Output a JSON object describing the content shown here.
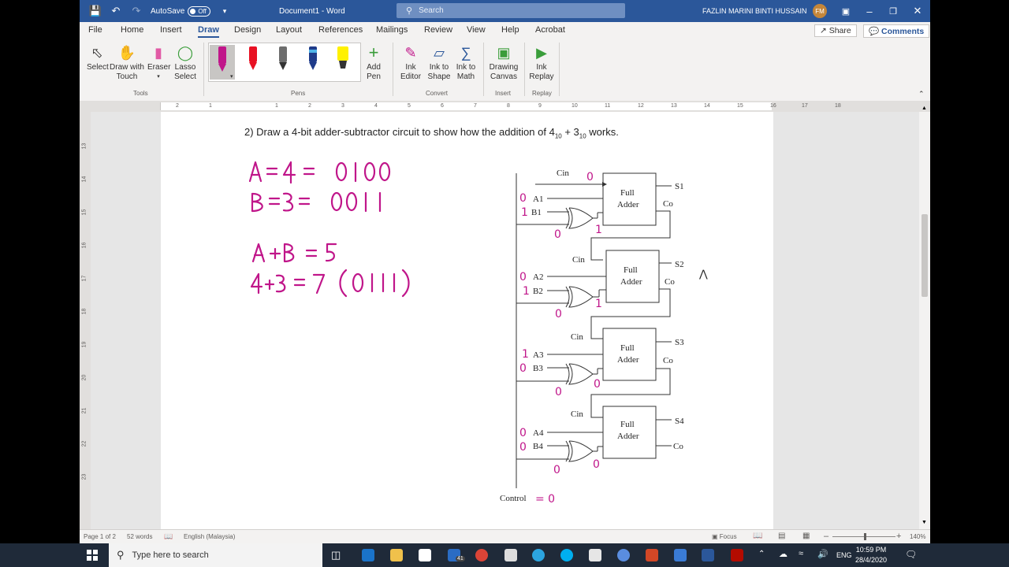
{
  "titlebar": {
    "autosave_label": "AutoSave",
    "autosave_state": "Off",
    "doc_title": "Document1  -  Word",
    "search_placeholder": "Search",
    "user_name": "FAZLIN MARINI BINTI HUSSAIN",
    "user_initials": "FM"
  },
  "tabs": [
    "File",
    "Home",
    "Insert",
    "Draw",
    "Design",
    "Layout",
    "References",
    "Mailings",
    "Review",
    "View",
    "Help",
    "Acrobat"
  ],
  "share_label": "Share",
  "comments_label": "Comments",
  "ribbon": {
    "select": "Select",
    "draw_touch_1": "Draw with",
    "draw_touch_2": "Touch",
    "eraser": "Eraser",
    "lasso_1": "Lasso",
    "lasso_2": "Select",
    "group_tools": "Tools",
    "group_pens": "Pens",
    "add_pen_1": "Add",
    "add_pen_2": "Pen",
    "ink_editor_1": "Ink",
    "ink_editor_2": "Editor",
    "ink_shape_1": "Ink to",
    "ink_shape_2": "Shape",
    "ink_math_1": "Ink to",
    "ink_math_2": "Math",
    "group_convert": "Convert",
    "drawing_canvas_1": "Drawing",
    "drawing_canvas_2": "Canvas",
    "group_insert": "Insert",
    "ink_replay_1": "Ink",
    "ink_replay_2": "Replay",
    "group_replay": "Replay"
  },
  "pens": [
    {
      "color": "#c0168a"
    },
    {
      "color": "#e81123"
    },
    {
      "color": "#7a7a7a"
    },
    {
      "color": "#1f3b8a"
    },
    {
      "color": "#fff100"
    }
  ],
  "ruler_numbers": [
    "2",
    "1",
    "1",
    "2",
    "3",
    "4",
    "5",
    "6",
    "7",
    "8",
    "9",
    "10",
    "11",
    "12",
    "13",
    "14",
    "15",
    "16",
    "17",
    "18"
  ],
  "vruler_numbers": [
    "13",
    "14",
    "15",
    "16",
    "17",
    "18",
    "19",
    "20",
    "21",
    "22",
    "23"
  ],
  "document": {
    "question_prefix": "2)  Draw a 4-bit adder-subtractor circuit to show how the addition of 4",
    "sub1": "10",
    "plus": " + 3",
    "sub2": "10",
    "suffix": " works.",
    "handwriting": {
      "line1": "A = 4 = 0100",
      "line2": "B = 3 = 0011",
      "line3": "A + B = 5",
      "line4": "4+3 = 7 (0111)"
    },
    "circuit": {
      "adder_label_1": "Full",
      "adder_label_2": "Adder",
      "cin": "Cin",
      "co": "Co",
      "control": "Control",
      "stages": [
        {
          "a": "A1",
          "b": "B1",
          "s": "S1",
          "a_val": "0",
          "b_val": "1",
          "xor_in": "0",
          "xor_out": "1"
        },
        {
          "a": "A2",
          "b": "B2",
          "s": "S2",
          "a_val": "0",
          "b_val": "1",
          "xor_in": "0",
          "xor_out": "1"
        },
        {
          "a": "A3",
          "b": "B3",
          "s": "S3",
          "a_val": "1",
          "b_val": "0",
          "xor_in": "0",
          "xor_out": "0"
        },
        {
          "a": "A4",
          "b": "B4",
          "s": "S4",
          "a_val": "0",
          "b_val": "0",
          "xor_in": "0",
          "xor_out": "0"
        }
      ],
      "cin_val": "0",
      "control_val": "= 0"
    }
  },
  "statusbar": {
    "page": "Page 1 of 2",
    "words": "52 words",
    "language": "English (Malaysia)",
    "focus": "Focus",
    "zoom": "140%"
  },
  "taskbar": {
    "search_placeholder": "Type here to search",
    "mail_badge": "41",
    "lang": "ENG",
    "time": "10:59 PM",
    "date": "28/4/2020"
  }
}
